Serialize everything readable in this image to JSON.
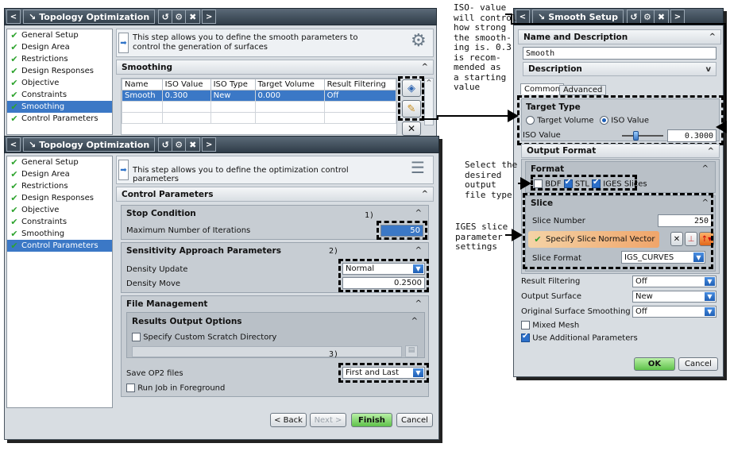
{
  "win1": {
    "title": "Topology Optimization",
    "steps": [
      "General Setup",
      "Design Area",
      "Restrictions",
      "Design Responses",
      "Objective",
      "Constraints",
      "Smoothing",
      "Control Parameters"
    ],
    "selected_step": "Smoothing",
    "info": "This step allows you to define the smooth parameters to control the generation of surfaces",
    "section": "Smoothing",
    "table": {
      "headers": [
        "Name",
        "ISO Value",
        "ISO Type",
        "Target Volume",
        "Result Filtering"
      ],
      "rows": [
        [
          "Smooth",
          "0.300",
          "New",
          "0.000",
          "Off"
        ]
      ]
    }
  },
  "win2": {
    "title": "Topology Optimization",
    "steps": [
      "General Setup",
      "Design Area",
      "Restrictions",
      "Design Responses",
      "Objective",
      "Constraints",
      "Smoothing",
      "Control Parameters"
    ],
    "selected_step": "Control Parameters",
    "info": "This step allows you to define the optimization control parameters",
    "section": "Control Parameters",
    "stop": {
      "title": "Stop Condition",
      "max_iter_label": "Maximum Number of Iterations",
      "max_iter_value": "50",
      "marker": "1)"
    },
    "sensitivity": {
      "title": "Sensitivity Approach Parameters",
      "marker": "2)",
      "density_update_label": "Density Update",
      "density_update_value": "Normal",
      "density_move_label": "Density Move",
      "density_move_value": "0.2500"
    },
    "file_mgmt": {
      "title": "File Management",
      "results_title": "Results Output Options",
      "scratch_label": "Specify Custom Scratch Directory",
      "marker": "3)",
      "save_op2_label": "Save OP2 files",
      "save_op2_value": "First and Last",
      "foreground_label": "Run Job in Foreground"
    },
    "buttons": {
      "back": "< Back",
      "next": "Next >",
      "finish": "Finish",
      "cancel": "Cancel"
    }
  },
  "win3": {
    "title": "Smooth Setup",
    "name_desc": "Name and Description",
    "name_value": "Smooth",
    "description": "Description",
    "tabs": [
      "Common",
      "Advanced"
    ],
    "target_type": {
      "title": "Target Type",
      "opt1": "Target Volume",
      "opt2": "ISO Value",
      "selected": "ISO Value"
    },
    "iso_label": "ISO Value",
    "iso_value": "0.3000",
    "iso_slider_fraction": 0.3,
    "output_format": "Output Format",
    "format": {
      "title": "Format",
      "bdf": "BDF",
      "stl": "STL",
      "iges": "IGES Slices"
    },
    "slice": {
      "title": "Slice",
      "number_label": "Slice Number",
      "number_value": "250",
      "normal_label": "Specify Slice Normal Vector",
      "format_label": "Slice Format",
      "format_value": "IGS_CURVES"
    },
    "result_filtering": {
      "label": "Result Filtering",
      "value": "Off"
    },
    "output_surface": {
      "label": "Output Surface",
      "value": "New"
    },
    "orig_smoothing": {
      "label": "Original Surface Smoothing",
      "value": "Off"
    },
    "mixed_mesh": "Mixed Mesh",
    "use_additional": "Use Additional Parameters",
    "ok": "OK",
    "cancel": "Cancel"
  },
  "annotations": {
    "iso": [
      "ISO- value",
      "will control",
      "how strong",
      "the smooth-",
      "ing is. 0.3",
      "is recom-",
      "mended as",
      "a starting",
      "value"
    ],
    "format": [
      "Select the",
      "desired",
      "output",
      "file type"
    ],
    "slice": [
      "IGES slice",
      "parameter",
      "settings"
    ]
  }
}
